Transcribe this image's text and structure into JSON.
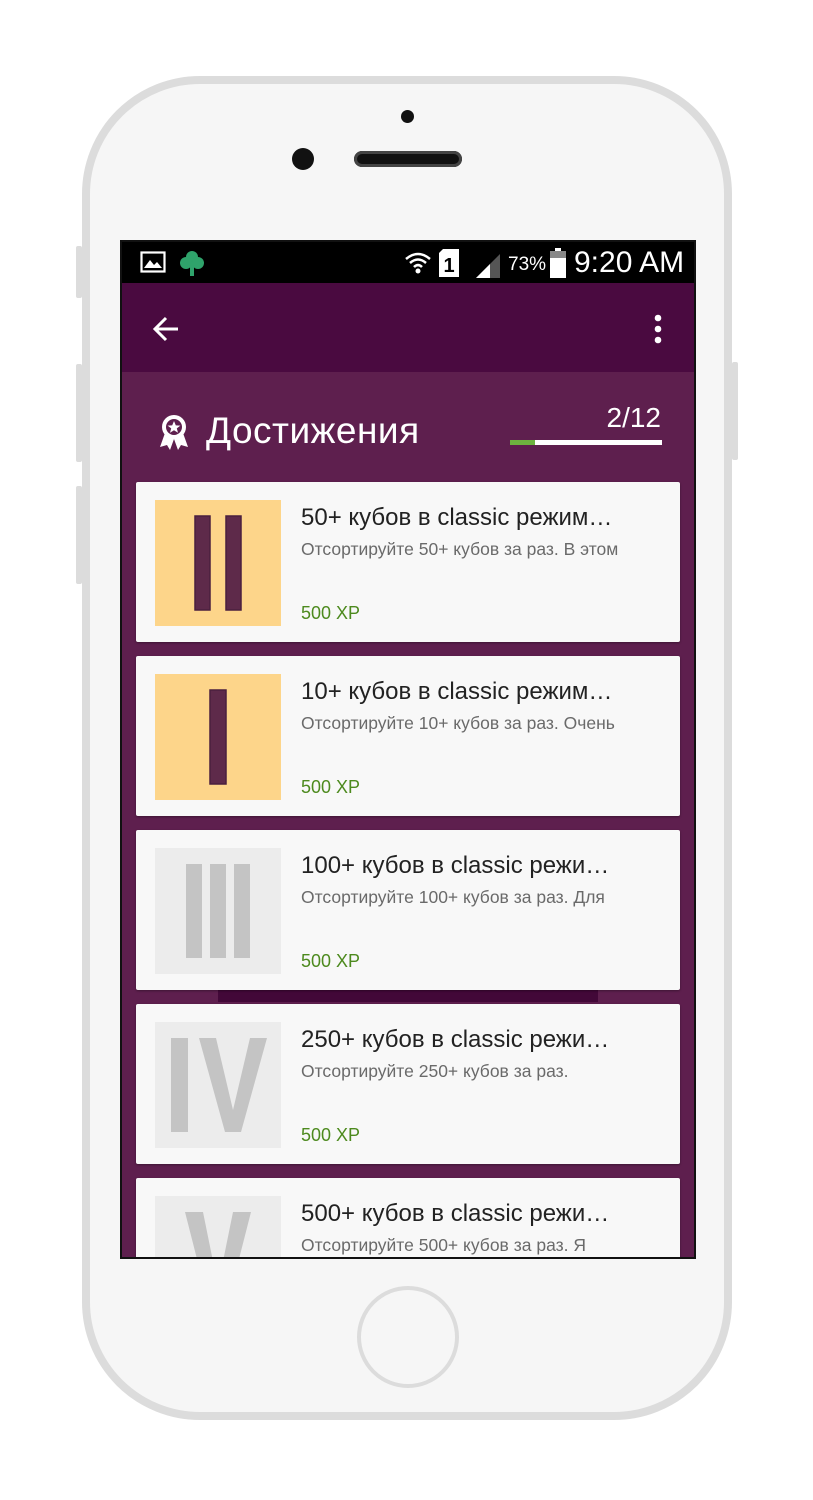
{
  "status_bar": {
    "icons": [
      "image-icon",
      "clover-icon",
      "wifi-icon",
      "sim-1-icon",
      "signal-icon",
      "battery-icon"
    ],
    "battery": "73%",
    "time": "9:20 AM"
  },
  "app_bar": {
    "back_icon": "arrow-back-icon",
    "menu_icon": "more-vert-icon"
  },
  "header": {
    "title": "Достижения",
    "icon": "award-icon",
    "count": "2/12",
    "progress": 0.1667,
    "progress_color": "#6db33f"
  },
  "achievements": [
    {
      "numeral": "II",
      "unlocked": true,
      "title": "50+ кубов в classic режим…",
      "description": "Отсортируйте 50+ кубов за раз. В этом",
      "xp": "500 XP"
    },
    {
      "numeral": "I",
      "unlocked": true,
      "title": "10+ кубов в classic режим…",
      "description": "Отсортируйте 10+ кубов за раз. Очень",
      "xp": "500 XP"
    },
    {
      "numeral": "III",
      "unlocked": false,
      "title": "100+ кубов в classic режи…",
      "description": "Отсортируйте 100+ кубов за раз. Для",
      "xp": "500 XP"
    },
    {
      "numeral": "IV",
      "unlocked": false,
      "title": "250+ кубов в classic режи…",
      "description": "Отсортируйте 250+ кубов за раз.",
      "xp": "500 XP"
    },
    {
      "numeral": "V",
      "unlocked": false,
      "title": "500+ кубов в classic режи…",
      "description": "Отсортируйте 500+ кубов за раз. Я",
      "xp": ""
    }
  ],
  "colors": {
    "app_bar": "#4a0a40",
    "background": "#5e1f4e",
    "unlocked_tile": "#fdd58a",
    "unlocked_glyph": "#5e2a4a",
    "locked_tile": "#ececec",
    "locked_glyph": "#c4c4c4",
    "xp_text": "#4d8a1e"
  }
}
